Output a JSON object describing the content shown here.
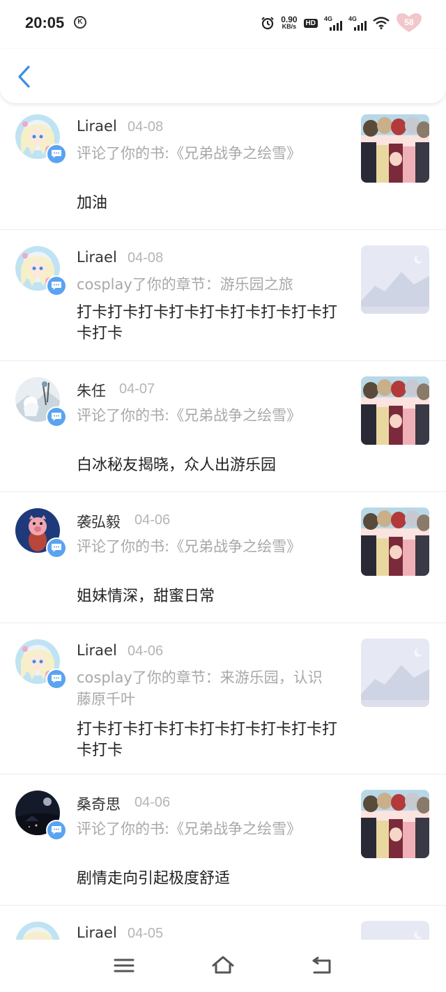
{
  "status_bar": {
    "time": "20:05",
    "k_icon": "K",
    "speed_value": "0.90",
    "speed_unit": "KB/s",
    "hd_label": "HD",
    "signal1_label": "4G",
    "signal2_label": "4G",
    "battery": "58",
    "icons": [
      "alarm-icon",
      "hd-icon",
      "signal-icon",
      "signal-icon",
      "wifi-icon",
      "battery-icon"
    ]
  },
  "header": {
    "back_icon": "chevron-left-icon",
    "accent_color": "#3a8ee6"
  },
  "items": [
    {
      "name": "Lirael",
      "date": "04-08",
      "sub": "评论了你的书:《兄弟战争之绘雪》",
      "comment": "加油",
      "avatar": "anime-girl",
      "thumb": "anime-cover"
    },
    {
      "name": "Lirael",
      "date": "04-08",
      "sub": "cosplay了你的章节：游乐园之旅",
      "comment": "打卡打卡打卡打卡打卡打卡打卡打卡打卡打卡",
      "avatar": "anime-girl",
      "thumb": "placeholder"
    },
    {
      "name": "朱任",
      "date": "04-07",
      "sub": "评论了你的书:《兄弟战争之绘雪》",
      "comment": "白冰秘友揭晓，众人出游乐园",
      "avatar": "snow-scene",
      "thumb": "anime-cover"
    },
    {
      "name": "袭弘毅",
      "date": "04-06",
      "sub": "评论了你的书:《兄弟战争之绘雪》",
      "comment": "姐妹情深，甜蜜日常",
      "avatar": "pig",
      "thumb": "anime-cover"
    },
    {
      "name": "Lirael",
      "date": "04-06",
      "sub": "cosplay了你的章节：来游乐园，认识藤原千叶",
      "comment": "打卡打卡打卡打卡打卡打卡打卡打卡打卡打卡",
      "avatar": "anime-girl",
      "thumb": "placeholder"
    },
    {
      "name": "桑奇思",
      "date": "04-06",
      "sub": "评论了你的书:《兄弟战争之绘雪》",
      "comment": "剧情走向引起极度舒适",
      "avatar": "night-sky",
      "thumb": "anime-cover"
    },
    {
      "name": "Lirael",
      "date": "04-05",
      "sub": "",
      "comment": "",
      "avatar": "anime-girl",
      "thumb": "placeholder"
    }
  ],
  "bottom_nav": {
    "icons": [
      "menu-icon",
      "home-icon",
      "back-icon"
    ]
  }
}
